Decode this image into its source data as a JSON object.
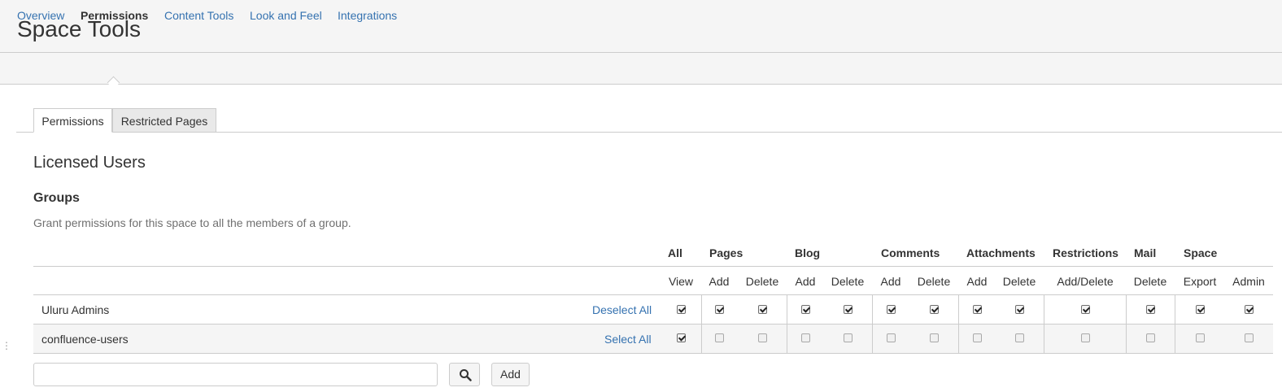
{
  "header": {
    "title": "Space Tools"
  },
  "nav": {
    "items": [
      {
        "label": "Overview"
      },
      {
        "label": "Permissions",
        "active": true
      },
      {
        "label": "Content Tools"
      },
      {
        "label": "Look and Feel"
      },
      {
        "label": "Integrations"
      }
    ]
  },
  "tabs": [
    {
      "label": "Permissions",
      "active": true
    },
    {
      "label": "Restricted Pages",
      "active": false
    }
  ],
  "section": {
    "title": "Licensed Users",
    "subtitle": "Groups",
    "description": "Grant permissions for this space to all the members of a group."
  },
  "table": {
    "categories": [
      "All",
      "Pages",
      "Blog",
      "Comments",
      "Attachments",
      "Restrictions",
      "Mail",
      "Space"
    ],
    "columns": [
      "View",
      "Add",
      "Delete",
      "Add",
      "Delete",
      "Add",
      "Delete",
      "Add",
      "Delete",
      "Add/Delete",
      "Delete",
      "Export",
      "Admin"
    ],
    "rows": [
      {
        "name": "Uluru Admins",
        "action": "Deselect All",
        "checked": [
          true,
          true,
          true,
          true,
          true,
          true,
          true,
          true,
          true,
          true,
          true,
          true,
          true
        ]
      },
      {
        "name": "confluence-users",
        "action": "Select All",
        "checked": [
          true,
          false,
          false,
          false,
          false,
          false,
          false,
          false,
          false,
          false,
          false,
          false,
          false
        ]
      }
    ]
  },
  "add_group": {
    "input_value": "",
    "search_icon": "search-icon",
    "add_label": "Add"
  },
  "colors": {
    "link": "#3572b0",
    "header_bg": "#f5f5f5",
    "border": "#cccccc"
  }
}
